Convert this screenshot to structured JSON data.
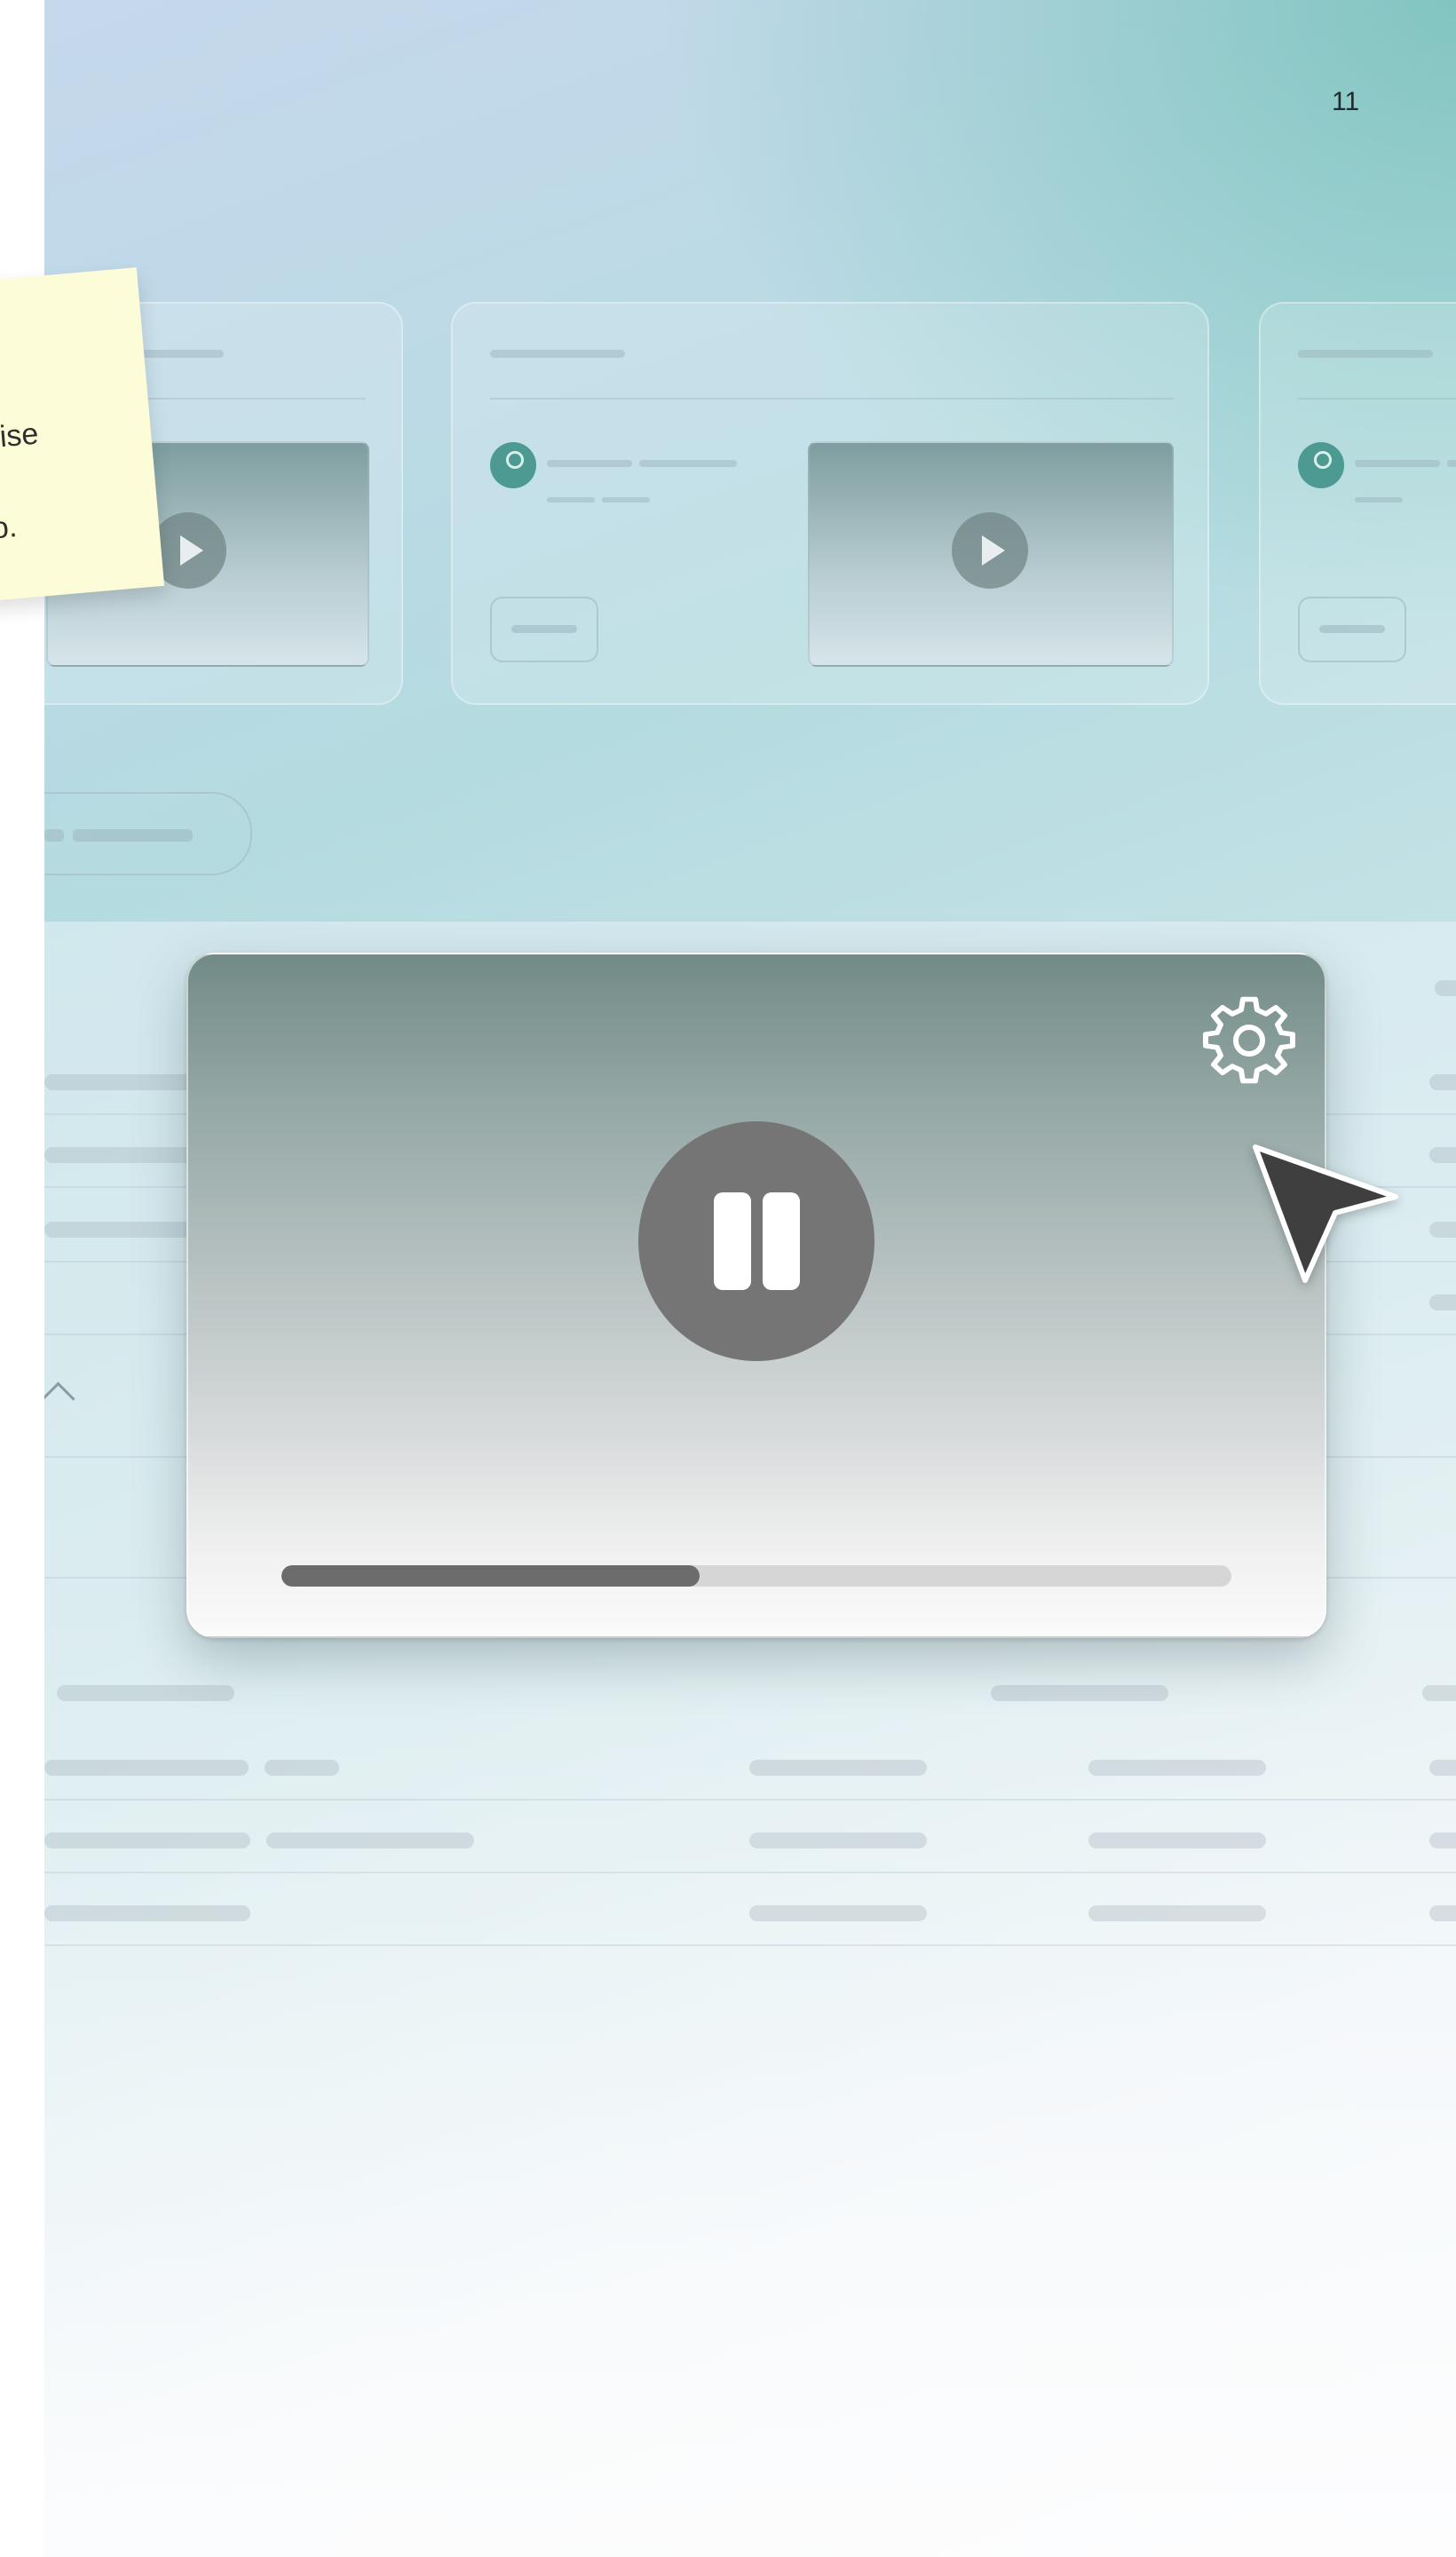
{
  "page": {
    "number": "11"
  },
  "sticky_note": {
    "line1": "ise",
    "line2": "o."
  },
  "video_player": {
    "state": "playing",
    "progress": 0.44,
    "controls": {
      "pause_icon": "pause-icon",
      "settings_icon": "gear-icon"
    }
  },
  "cursor": {
    "icon": "arrow-pointer-icon"
  },
  "colors": {
    "accent_teal": "#4d9a93",
    "player_button": "#757575",
    "progress_fill": "#6c6c6c",
    "progress_track": "#d6d6d6",
    "sticky_note": "#fdfcd9"
  }
}
